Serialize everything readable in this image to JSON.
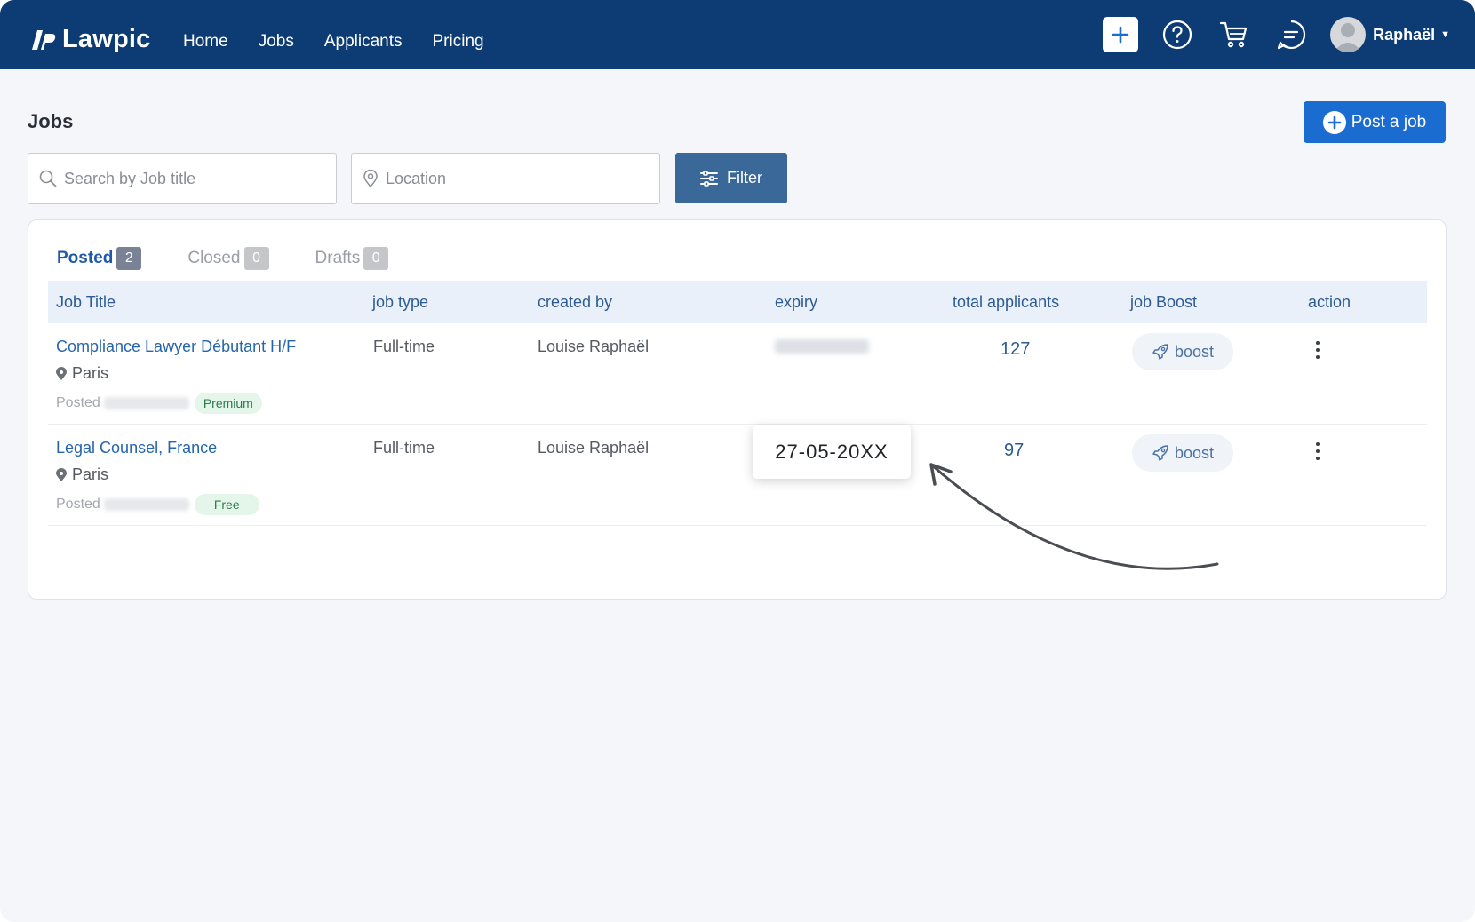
{
  "brand": {
    "name": "Lawpic"
  },
  "nav": {
    "links": [
      "Home",
      "Jobs",
      "Applicants",
      "Pricing"
    ],
    "user_name": "Raphaël"
  },
  "page": {
    "title": "Jobs",
    "post_button_label": "Post a job"
  },
  "search": {
    "title_placeholder": "Search by Job title",
    "location_placeholder": "Location",
    "filter_label": "Filter"
  },
  "tabs": [
    {
      "label": "Posted",
      "count": "2",
      "active": true
    },
    {
      "label": "Closed",
      "count": "0",
      "active": false
    },
    {
      "label": "Drafts",
      "count": "0",
      "active": false
    }
  ],
  "table": {
    "headers": [
      "Job Title",
      "job type",
      "created by",
      "expiry",
      "total applicants",
      "job Boost",
      "action"
    ],
    "rows": [
      {
        "title": "Compliance Lawyer Débutant H/F",
        "location": "Paris",
        "posted_label": "Posted",
        "plan": "Premium",
        "job_type": "Full-time",
        "created_by": "Louise Raphaël",
        "applicants": "127",
        "boost_label": "boost"
      },
      {
        "title": "Legal Counsel, France",
        "location": "Paris",
        "posted_label": "Posted",
        "plan": "Free",
        "job_type": "Full-time",
        "created_by": "Louise Raphaël",
        "applicants": "97",
        "boost_label": "boost"
      }
    ]
  },
  "annotation": {
    "expiry_date": "27-05-20XX"
  },
  "colors": {
    "navbar": "#0d3b73",
    "primary_button": "#1a6cd1",
    "filter_button": "#3a6898",
    "link": "#2565ae",
    "header_row": "#eaf0fa"
  }
}
